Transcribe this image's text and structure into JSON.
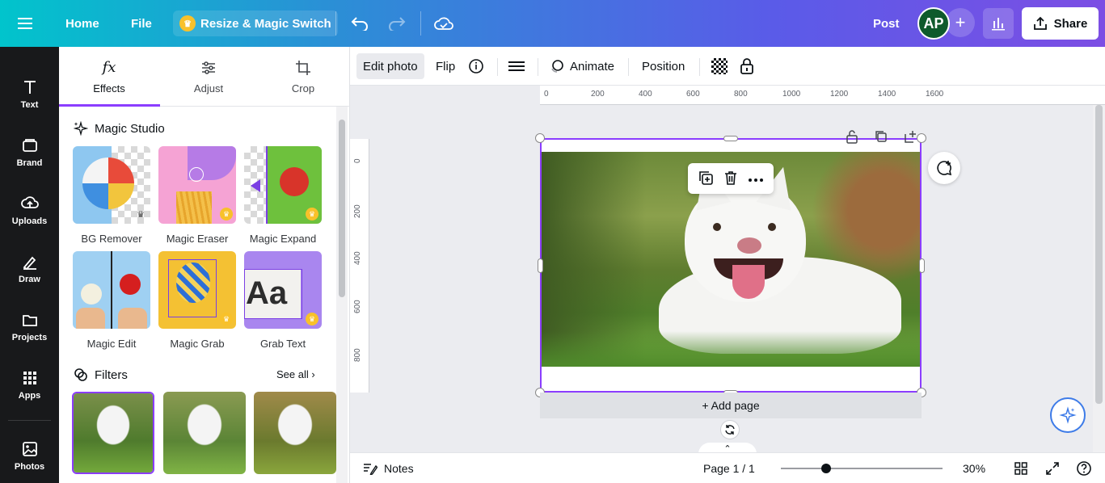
{
  "topbar": {
    "home": "Home",
    "file": "File",
    "resize": "Resize & Magic Switch",
    "post": "Post",
    "avatar_initials": "AP",
    "share": "Share",
    "colors": {
      "avatar": "#0e5a2c",
      "crown": "#f8c12a"
    }
  },
  "rail": [
    {
      "label": "Text",
      "icon": "text-icon"
    },
    {
      "label": "Brand",
      "icon": "brand-icon"
    },
    {
      "label": "Uploads",
      "icon": "uploads-icon"
    },
    {
      "label": "Draw",
      "icon": "draw-icon"
    },
    {
      "label": "Projects",
      "icon": "folder-icon"
    },
    {
      "label": "Apps",
      "icon": "apps-icon"
    },
    {
      "label": "Photos",
      "icon": "photos-icon"
    }
  ],
  "panel": {
    "tabs": [
      {
        "label": "Effects",
        "icon": "fx-icon"
      },
      {
        "label": "Adjust",
        "icon": "sliders-icon"
      },
      {
        "label": "Crop",
        "icon": "crop-icon"
      }
    ],
    "magic_studio": "Magic Studio",
    "tools": [
      {
        "label": "BG Remover"
      },
      {
        "label": "Magic Eraser"
      },
      {
        "label": "Magic Expand"
      },
      {
        "label": "Magic Edit"
      },
      {
        "label": "Magic Grab"
      },
      {
        "label": "Grab Text"
      }
    ],
    "filters_title": "Filters",
    "see_all": "See all"
  },
  "toolbar": {
    "edit_photo": "Edit photo",
    "flip": "Flip",
    "animate": "Animate",
    "position": "Position"
  },
  "ruler": {
    "h": [
      "0",
      "200",
      "400",
      "600",
      "800",
      "1000",
      "1200",
      "1400",
      "1600"
    ],
    "v": [
      "0",
      "200",
      "400",
      "600",
      "800"
    ]
  },
  "canvas": {
    "add_page": "+ Add page"
  },
  "bottombar": {
    "notes": "Notes",
    "page": "Page 1 / 1",
    "zoom": "30%",
    "zoom_level": 0.3
  }
}
